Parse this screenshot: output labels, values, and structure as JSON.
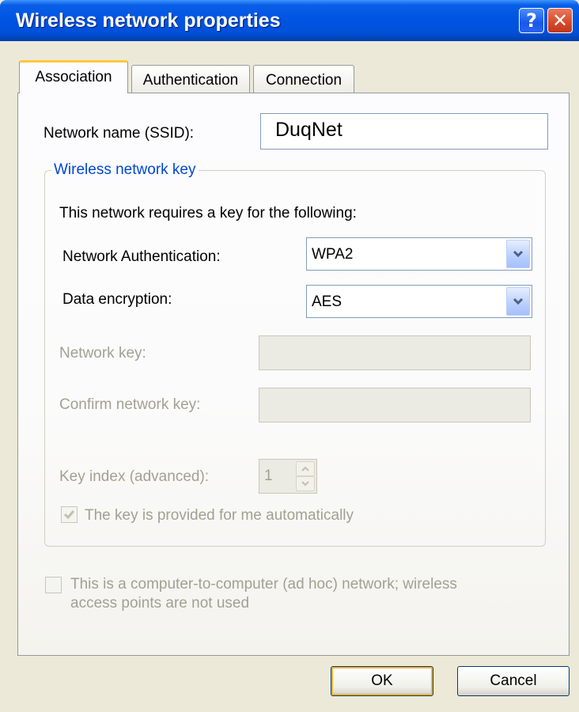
{
  "window": {
    "title": "Wireless network properties",
    "help_glyph": "?",
    "close_glyph": "✕"
  },
  "tabs": [
    {
      "label": "Association",
      "active": true
    },
    {
      "label": "Authentication",
      "active": false
    },
    {
      "label": "Connection",
      "active": false
    }
  ],
  "association": {
    "ssid_label": "Network name (SSID):",
    "ssid_value": "DuqNet",
    "group_title": "Wireless network key",
    "requires_text": "This network requires a key for the following:",
    "auth_label": "Network Authentication:",
    "auth_value": "WPA2",
    "encryption_label": "Data encryption:",
    "encryption_value": "AES",
    "network_key_label": "Network key:",
    "network_key_value": "",
    "confirm_key_label": "Confirm network key:",
    "confirm_key_value": "",
    "key_index_label": "Key index (advanced):",
    "key_index_value": "1",
    "auto_key_label": "The key is provided for me automatically",
    "auto_key_checked": true,
    "adhoc_label_line1": "This is a computer-to-computer (ad hoc) network; wireless",
    "adhoc_label_line2": "access points are not used",
    "adhoc_checked": false
  },
  "buttons": {
    "ok_label": "OK",
    "cancel_label": "Cancel"
  },
  "colors": {
    "titlebar": "#0054e3",
    "group_title": "#0046d5",
    "disabled_text": "#a1a192",
    "dialog_bg": "#ece9d8"
  },
  "icons": {
    "help": "help-icon",
    "close": "close-icon",
    "dropdown": "chevron-down-icon",
    "check": "checkmark-icon"
  }
}
